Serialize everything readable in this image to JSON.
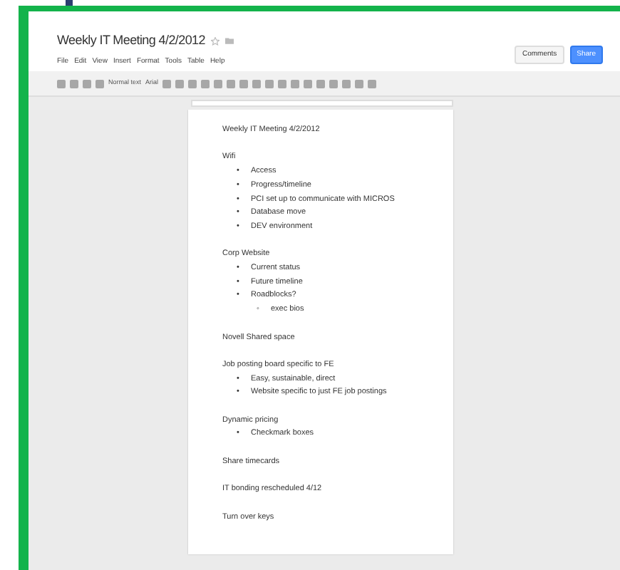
{
  "document": {
    "title": "Weekly IT Meeting 4/2/2012"
  },
  "menu": [
    "File",
    "Edit",
    "View",
    "Insert",
    "Format",
    "Tools",
    "Table",
    "Help"
  ],
  "header_buttons": [
    {
      "label": "Comments",
      "kind": "plain"
    },
    {
      "label": "Share",
      "kind": "primary"
    }
  ],
  "toolbar": {
    "style": "Normal text",
    "font": "Arial"
  },
  "page": {
    "title": "Weekly IT Meeting 4/2/2012",
    "sections": [
      {
        "heading": "Wifi",
        "items": [
          {
            "marker": "•",
            "text": "Access"
          },
          {
            "marker": "•",
            "text": "Progress/timeline"
          },
          {
            "marker": "•",
            "text": "PCI set up to communicate with MICROS"
          },
          {
            "marker": "•",
            "text": "Database move"
          },
          {
            "marker": "•",
            "text": "DEV environment"
          }
        ]
      },
      {
        "heading": "Corp Website",
        "items": [
          {
            "marker": "•",
            "text": "Current status"
          },
          {
            "marker": "•",
            "text": "Future timeline"
          },
          {
            "marker": "•",
            "text": "Roadblocks?",
            "children": [
              {
                "marker": "◦",
                "text": "exec bios"
              }
            ]
          }
        ]
      },
      {
        "heading": "Novell Shared space"
      },
      {
        "heading": "Job posting board specific to FE",
        "items": [
          {
            "marker": "•",
            "text": "Easy, sustainable, direct"
          },
          {
            "marker": "•",
            "text": "Website specific to just FE job postings"
          }
        ]
      },
      {
        "heading": "Dynamic pricing",
        "items": [
          {
            "marker": "•",
            "text": "Checkmark boxes"
          }
        ]
      },
      {
        "heading": "Share timecards"
      },
      {
        "heading": "IT bonding rescheduled 4/12"
      },
      {
        "heading": "Turn over keys"
      }
    ]
  }
}
